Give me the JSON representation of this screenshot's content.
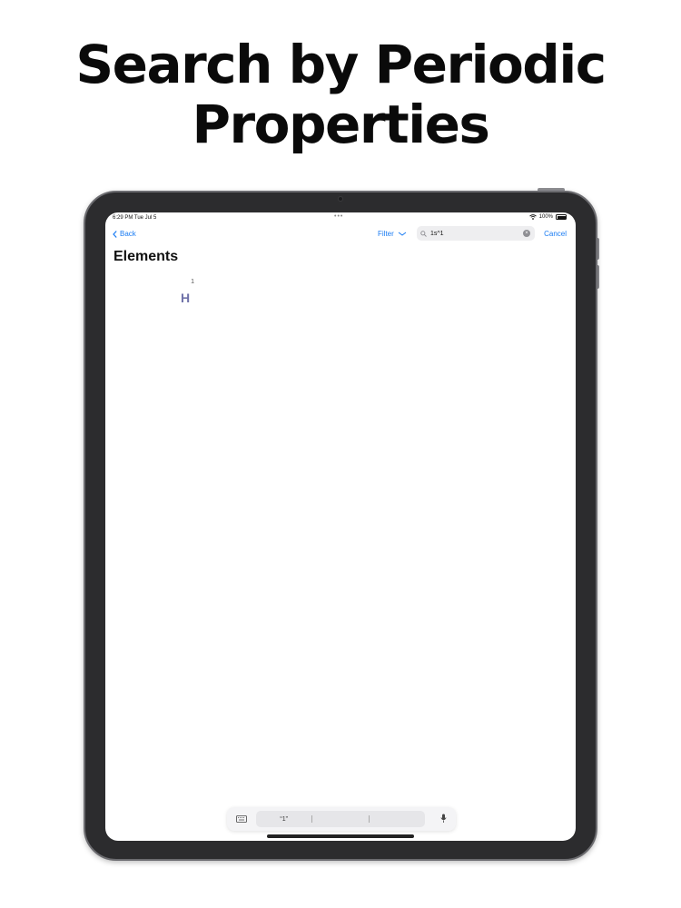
{
  "headline": {
    "line1": "Search by Periodic",
    "line2": "Properties"
  },
  "status": {
    "time": "6:29 PM  Tue Jul 5",
    "dots": "•••",
    "battery": "100%"
  },
  "nav": {
    "back_label": "Back",
    "filter_label": "Filter",
    "search_value": "1s^1",
    "cancel_label": "Cancel"
  },
  "page": {
    "title": "Elements"
  },
  "results": [
    {
      "number": "1",
      "symbol": "H"
    }
  ],
  "keyboard_bar": {
    "suggestions": [
      "“1”",
      "",
      ""
    ]
  },
  "colors": {
    "accent": "#1a7cf3",
    "element_symbol": "#6f72a9",
    "device_frame": "#2c2c2e"
  }
}
